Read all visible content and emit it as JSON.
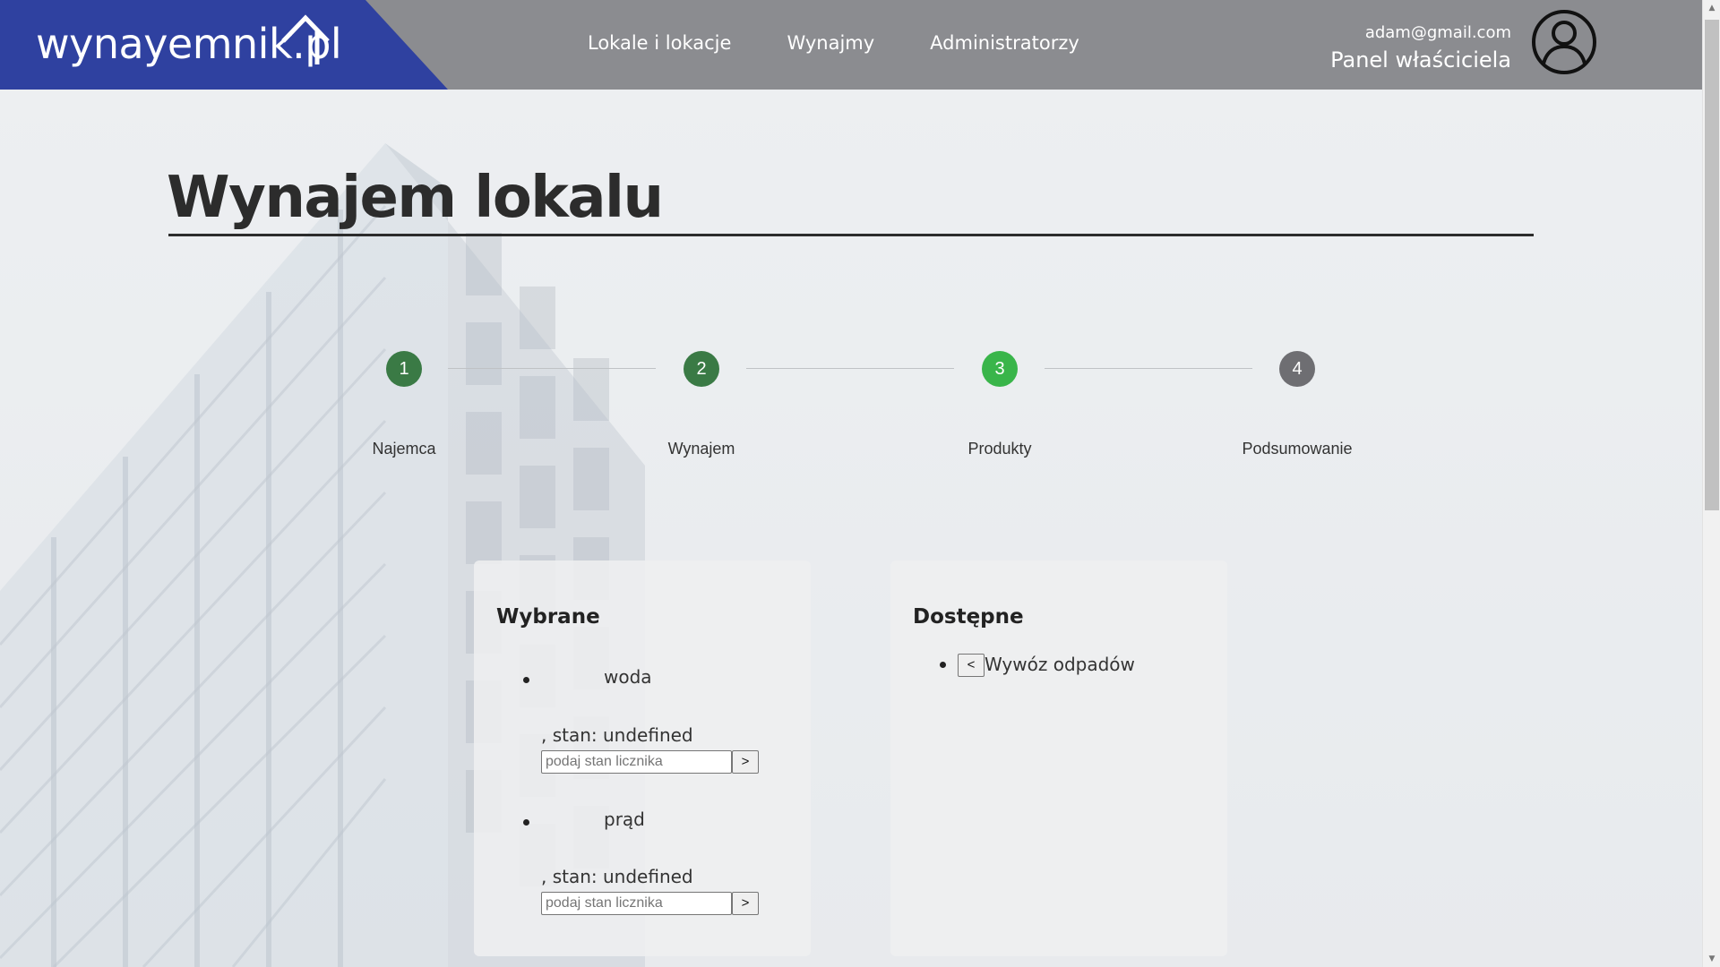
{
  "header": {
    "logo_text": "wynayemnik.pl",
    "nav": [
      "Lokale i lokacje",
      "Wynajmy",
      "Administratorzy"
    ],
    "user_email": "adam@gmail.com",
    "user_role": "Panel właściciela",
    "avatar_icon": "user-circle-icon"
  },
  "colors": {
    "header_bg": "#8b8c90",
    "logo_bg": "#2f41a0",
    "step_done": "#3a7a45",
    "step_active": "#39b54a",
    "step_pending": "#6e6e72"
  },
  "page": {
    "title": "Wynajem lokalu"
  },
  "steps": [
    {
      "number": "1",
      "label": "Najemca",
      "state": "done"
    },
    {
      "number": "2",
      "label": "Wynajem",
      "state": "done"
    },
    {
      "number": "3",
      "label": "Produkty",
      "state": "active"
    },
    {
      "number": "4",
      "label": "Podsumowanie",
      "state": "pending"
    }
  ],
  "selected": {
    "title": "Wybrane",
    "items": [
      {
        "name": "woda",
        "state_text": ", stan: undefined",
        "input_placeholder": "podaj stan licznika",
        "button_label": ">"
      },
      {
        "name": "prąd",
        "state_text": ", stan: undefined",
        "input_placeholder": "podaj stan licznika",
        "button_label": ">"
      }
    ]
  },
  "available": {
    "title": "Dostępne",
    "items": [
      {
        "name": "Wywóz odpadów",
        "button_label": "<"
      }
    ]
  }
}
